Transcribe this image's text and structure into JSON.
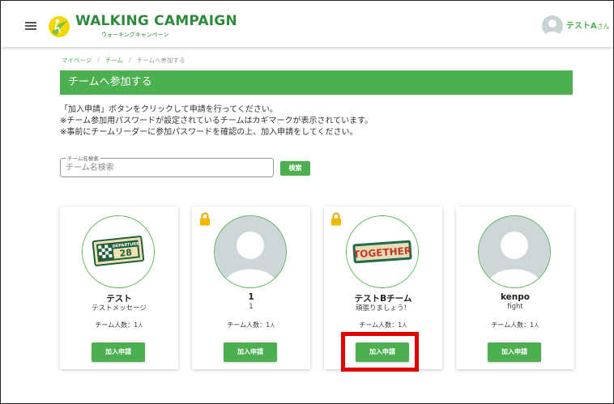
{
  "header": {
    "logo_title": "WALKING CAMPAIGN",
    "logo_subtitle": "ウォーキングキャンペーン",
    "user_name": "テストA",
    "user_suffix": "さん"
  },
  "breadcrumb": {
    "items": [
      "マイページ",
      "チーム",
      "チームへ参加する"
    ],
    "separator": "/"
  },
  "page": {
    "title": "チームへ参加する",
    "description": [
      "「加入申請」ボタンをクリックして申請を行ってください。",
      "※チーム参加用パスワードが設定されているチームはカギマークが表示されています。",
      "※事前にチームリーダーに参加パスワードを確認の上、加入申請をしてください。"
    ]
  },
  "search": {
    "label": "チーム名検索",
    "placeholder": "チーム名検索",
    "button_label": "検索"
  },
  "teams": [
    {
      "name": "テスト",
      "message": "テストメッセージ",
      "count_label": "チーム人数：1",
      "unit": "人",
      "join_label": "加入申請",
      "locked": false,
      "image": "departure-28-badge"
    },
    {
      "name": "1",
      "message": "1",
      "count_label": "チーム人数：1",
      "unit": "人",
      "join_label": "加入申請",
      "locked": true,
      "image": "default-avatar"
    },
    {
      "name": "テストBチーム",
      "message": "頑張りましょう！",
      "count_label": "チーム人数：1",
      "unit": "人",
      "join_label": "加入申請",
      "locked": true,
      "image": "together-badge"
    },
    {
      "name": "kenpo",
      "message": "fight",
      "count_label": "チーム人数：1",
      "unit": "人",
      "join_label": "加入申請",
      "locked": false,
      "image": "default-avatar"
    }
  ],
  "colors": {
    "primary": "#4caf50",
    "highlight": "#e00000",
    "lock": "#f5b800"
  },
  "departure_badge": {
    "top": "DEPARTURE",
    "number": "28"
  },
  "together_badge": {
    "text": "TOGETHER"
  }
}
